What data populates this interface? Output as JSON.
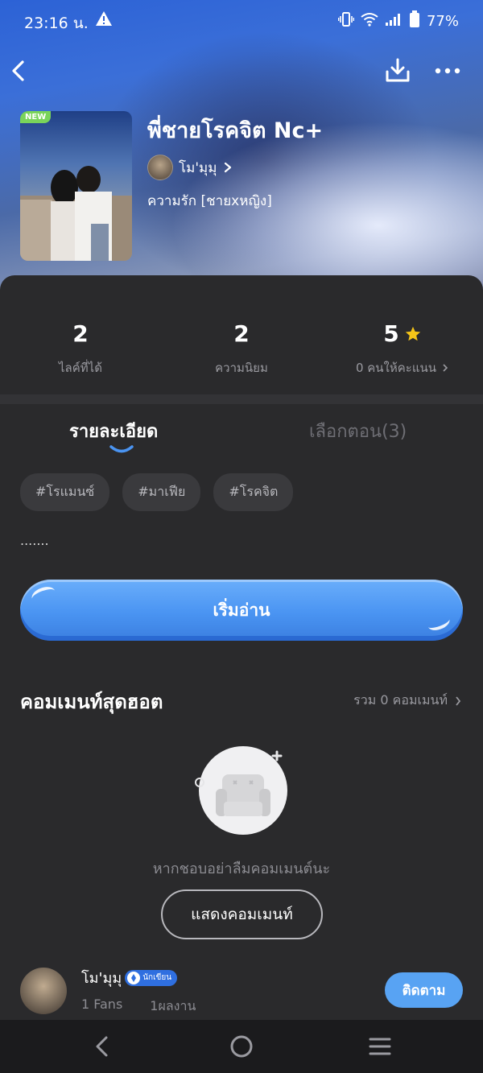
{
  "status_bar": {
    "time": "23:16 น.",
    "battery": "77%"
  },
  "story": {
    "title": "พี่ชายโรคจิต Nc+",
    "badge": "NEW",
    "author": "โม'มุมุ",
    "genre": "ความรัก [ชายxหญิง]"
  },
  "stats": [
    {
      "value": "2",
      "label": "ไลค์ที่ได้"
    },
    {
      "value": "2",
      "label": "ความนิยม"
    },
    {
      "value": "5",
      "label": "0 คนให้คะแนน"
    }
  ],
  "tabs": {
    "details": "รายละเอียด",
    "episodes": "เลือกตอน(3)"
  },
  "tags": [
    "#โรแมนซ์",
    "#มาเฟีย",
    "#โรคจิต"
  ],
  "synopsis": ".......",
  "read_button": "เริ่มอ่าน",
  "comments": {
    "title": "คอมเมนท์สุดฮอต",
    "total": "รวม 0 คอมเมนท์",
    "empty_text": "หากชอบอย่าลืมคอมเมนต์นะ",
    "show_button": "แสดงคอมเมนท์"
  },
  "author_card": {
    "name": "โม'มุมุ",
    "badge": "นักเขียน",
    "fans": "1 Fans",
    "works": "1ผลงาน",
    "follow": "ติดตาม"
  },
  "colors": {
    "accent": "#58a3f3",
    "star": "#f5c518",
    "background": "#2a2a2c"
  }
}
